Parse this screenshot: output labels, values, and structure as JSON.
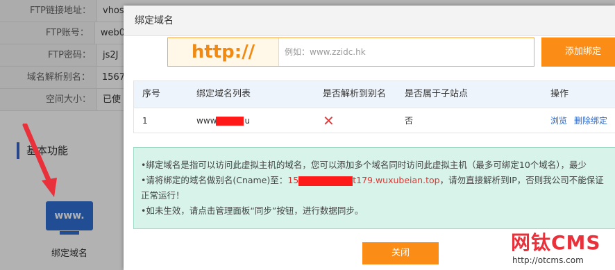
{
  "background": {
    "info_rows": [
      {
        "label": "FTP链接地址：",
        "value": "vhos"
      },
      {
        "label": "FTP账号：",
        "value": "web0"
      },
      {
        "label": "FTP密码：",
        "value": "js2J"
      },
      {
        "label": "域名解析别名：",
        "value": "1567"
      },
      {
        "label": "空间大小：",
        "value": "已使"
      }
    ],
    "section_title": "基本功能",
    "tile_text": "www.",
    "tile_label": "绑定域名"
  },
  "dialog": {
    "title": "绑定域名",
    "url_prefix": "http://",
    "url_placeholder": "例如：www.zzidc.hk",
    "add_button": "添加绑定",
    "table": {
      "headers": [
        "序号",
        "绑定域名列表",
        "是否解析到别名",
        "是否属于子站点",
        "操作"
      ],
      "rows": [
        {
          "index": "1",
          "domain_start": "www",
          "domain_end": "u",
          "resolved_icon": "✕",
          "subsite": "否",
          "op_browse": "浏览",
          "op_unbind": "删除绑定"
        }
      ]
    },
    "notice": {
      "line1": "•绑定域名是指可以访问此虚拟主机的域名，您可以添加多个域名同时访问此虚拟主机（最多可绑定10个域名），最少",
      "line2_a": "•请将绑定的域名做别名(Cname)至：",
      "line2_red_a": "15",
      "line2_red_b": "t179.wuxubeian.top",
      "line2_b": "，请勿直接解析到IP，否则我公司不能保证",
      "line3": "正常运行！",
      "line4": "•如未生效，请点击管理面板“同步”按钮，进行数据同步。"
    },
    "close_button": "关闭"
  },
  "watermark": {
    "brand": "网钛CMS",
    "url": "http://otcms.com"
  },
  "colors": {
    "accent_orange": "#fb8d16",
    "link_blue": "#2a66c6",
    "notice_bg": "#d7f3ea",
    "highlight_red": "#e8312d"
  }
}
